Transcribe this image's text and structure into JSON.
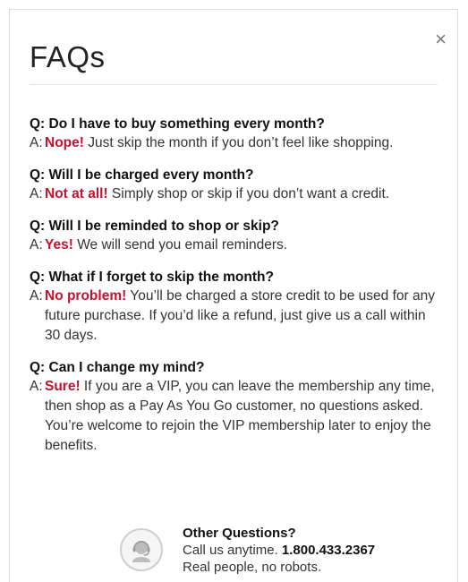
{
  "modal": {
    "title": "FAQs",
    "close_symbol": "×",
    "close_icon": "close-icon"
  },
  "faqs": [
    {
      "question": "Q: Do I have to buy something every month?",
      "answer_prefix": "A:",
      "answer_highlight": "Nope!",
      "answer_text": " Just skip the month if you don’t feel like shopping."
    },
    {
      "question": "Q: Will I be charged every month?",
      "answer_prefix": "A:",
      "answer_highlight": "Not at all!",
      "answer_text": " Simply shop or skip if you don’t want a credit."
    },
    {
      "question": "Q: Will I be reminded to shop or skip?",
      "answer_prefix": "A:",
      "answer_highlight": "Yes!",
      "answer_text": " We will send you email reminders."
    },
    {
      "question": "Q: What if I forget to skip the month?",
      "answer_prefix": "A:",
      "answer_highlight": "No problem!",
      "answer_text": " You’ll be charged a store credit to be used for any future purchase. If you’d like a refund, just give us a call within 30 days."
    },
    {
      "question": "Q: Can I change my mind?",
      "answer_prefix": "A:",
      "answer_highlight": "Sure!",
      "answer_text": " If you are a VIP, you can leave the membership any time, then shop as a Pay As You Go customer, no questions asked. You’re welcome to rejoin the VIP membership later to enjoy the benefits."
    }
  ],
  "contact": {
    "icon": "support-agent-icon",
    "title": "Other Questions?",
    "call_text": "Call us anytime. ",
    "phone": "1.800.433.2367",
    "tagline": "Real people, no robots."
  },
  "colors": {
    "highlight": "#c8102e",
    "text": "#333333",
    "divider": "#e4e4e4"
  }
}
